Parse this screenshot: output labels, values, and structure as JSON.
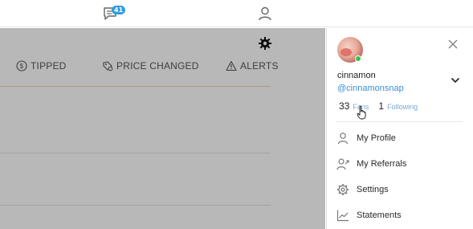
{
  "topbar": {
    "messages_icon": "chat-icon",
    "messages_badge": "41",
    "user_icon": "user-icon"
  },
  "main": {
    "settings_icon": "gear-icon",
    "filters": [
      {
        "icon": "dollar-circle-icon",
        "label": "TIPPED"
      },
      {
        "icon": "price-tag-icon",
        "label": "PRICE CHANGED"
      },
      {
        "icon": "warning-triangle-icon",
        "label": "ALERTS"
      }
    ]
  },
  "panel": {
    "username": "cinnamon",
    "handle": "@cinnamonsnap",
    "fans_count": "33",
    "fans_label": "Fans",
    "following_count": "1",
    "following_label": "Following",
    "online_color": "#3fbf3f",
    "link_color": "#3a8fd6",
    "menu": [
      {
        "icon": "user-icon",
        "label": "My Profile"
      },
      {
        "icon": "referrals-icon",
        "label": "My Referrals"
      },
      {
        "icon": "gear-icon",
        "label": "Settings"
      },
      {
        "icon": "chart-icon",
        "label": "Statements"
      }
    ]
  },
  "colors": {
    "badge": "#2f9ee0",
    "overlay": "rgba(0,0,0,0.28)"
  }
}
